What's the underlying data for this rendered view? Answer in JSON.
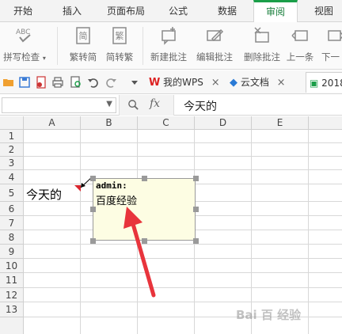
{
  "tabs": [
    "开始",
    "插入",
    "页面布局",
    "公式",
    "数据",
    "审阅",
    "视图"
  ],
  "active_tab": "审阅",
  "ribbon": {
    "spell_check": "拼写检查",
    "trad_to_simp": "繁转简",
    "simp_to_trad": "简转繁",
    "new_comment": "新建批注",
    "edit_comment": "编辑批注",
    "delete_comment": "删除批注",
    "prev": "上一条",
    "next": "下一"
  },
  "doc_tabs": {
    "wps": "我的WPS",
    "cloud": "云文档",
    "file": "2018"
  },
  "formula_bar": {
    "name_box": "",
    "fx_label": "fx",
    "content": "今天的"
  },
  "columns": [
    "A",
    "B",
    "C",
    "D",
    "E"
  ],
  "rows": [
    "1",
    "2",
    "3",
    "4",
    "5",
    "6",
    "7",
    "8",
    "9",
    "10",
    "11",
    "12",
    "13"
  ],
  "cells": {
    "A5": "今天的"
  },
  "comment": {
    "author": "admin:",
    "text": "百度经验"
  },
  "watermark": "Bai 百 经验",
  "colors": {
    "accent": "#1a9e48",
    "comment_bg": "#fdfde3",
    "arrow": "#e8343c"
  }
}
